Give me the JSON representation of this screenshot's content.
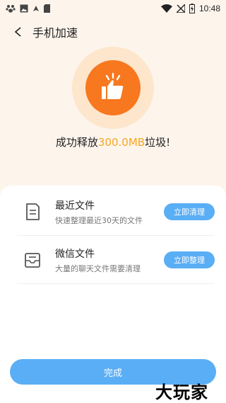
{
  "status_bar": {
    "time": "10:48",
    "left_icons": [
      "baidu-paw-icon",
      "image-icon",
      "navigation-icon",
      "sim-icon"
    ],
    "right_icons": [
      "wifi-icon",
      "no-signal-icon",
      "battery-charging-icon"
    ]
  },
  "header": {
    "title": "手机加速",
    "back_icon": "back-arrow-icon"
  },
  "hero": {
    "icon": "thumbs-up-icon",
    "accent_color": "#f7781f",
    "ring_color": "#fde6cc"
  },
  "result": {
    "prefix": "成功释放",
    "amount": "300.0MB",
    "suffix": "垃圾!",
    "amount_color": "#f5a623"
  },
  "items": [
    {
      "icon": "document-icon",
      "title": "最近文件",
      "subtitle": "快速整理最近30天的文件",
      "button": "立即清理"
    },
    {
      "icon": "inbox-icon",
      "title": "微信文件",
      "subtitle": "大量的聊天文件需要清理",
      "button": "立即整理"
    }
  ],
  "done_button": "完成",
  "watermark": "大玩家",
  "accent_blue": "#5aaef5"
}
